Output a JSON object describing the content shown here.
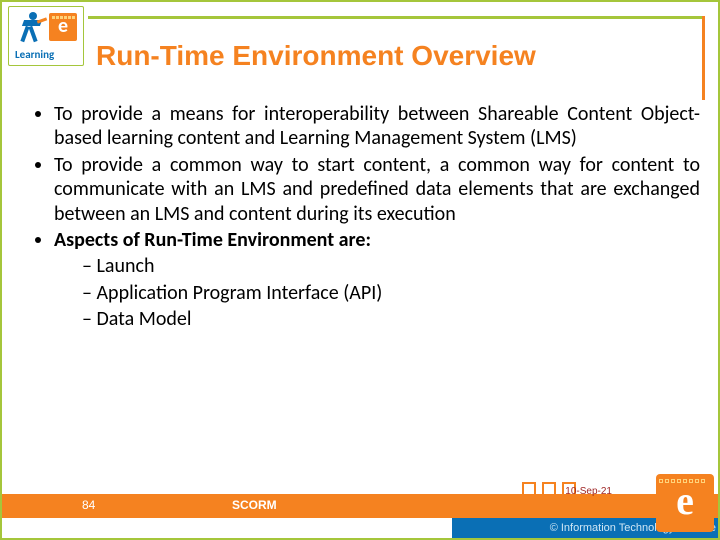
{
  "logo": {
    "text": "Learning",
    "e": "e"
  },
  "title": "Run-Time Environment Overview",
  "bullets": {
    "b1": "To provide a means for interoperability between Shareable Content Object-based learning content and Learning Management System (LMS)",
    "b2": "To provide a common way to start content,  a common way for content to communicate with an LMS and predefined data elements that are exchanged between an LMS and content during its execution",
    "b3": "Aspects of Run-Time Environment are:",
    "sub": {
      "s1": "Launch",
      "s2": "Application Program Interface (API)",
      "s3": "Data Model"
    }
  },
  "footer": {
    "slide_number": "84",
    "label": "SCORM",
    "date": "10-Sep-21",
    "org": "© Information Technology Institute"
  },
  "bigE": "e"
}
